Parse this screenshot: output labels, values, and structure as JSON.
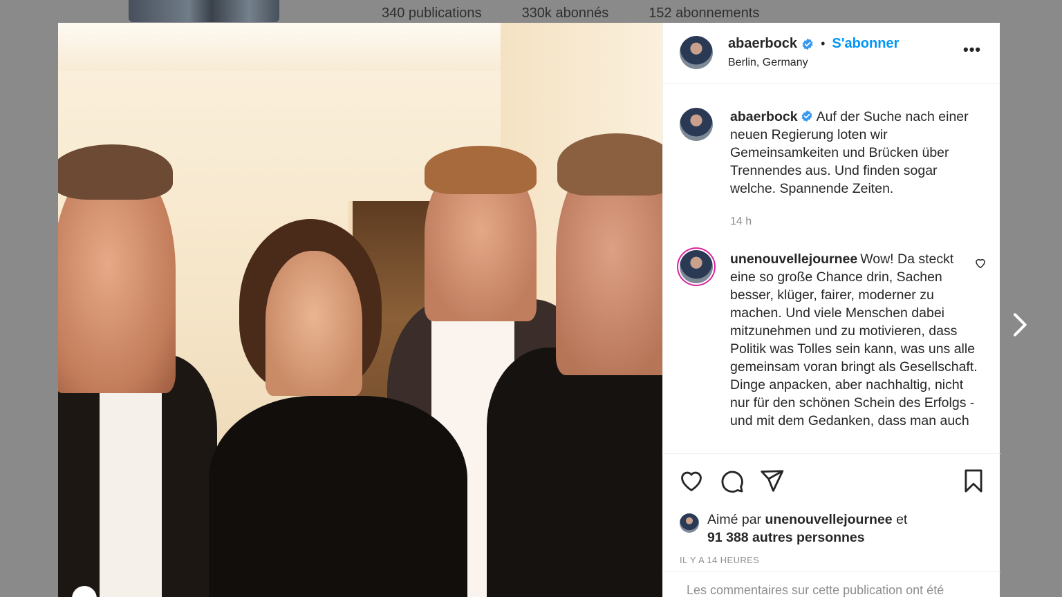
{
  "background_profile": {
    "posts": "340 publications",
    "followers": "330k abonnés",
    "following": "152 abonnements"
  },
  "post": {
    "author": "abaerbock",
    "follow_label": "S'abonner",
    "location": "Berlin, Germany",
    "more_label": "•••",
    "caption": "Auf der Suche nach einer neuen Regierung loten wir Gemeinsamkeiten und Brücken über Trennendes aus. Und finden sogar welche. Spannende Zeiten.",
    "caption_time": "14 h",
    "comment": {
      "author": "unenouvellejournee",
      "text": "Wow! Da steckt eine so große Chance drin, Sachen besser, klüger, fairer, moderner zu machen. Und viele Menschen dabei mitzunehmen und zu motivieren, dass Politik was Tolles sein kann, was uns alle gemeinsam voran bringt als Gesellschaft. Dinge anpacken, aber nachhaltig, nicht nur für den schönen Schein des Erfolgs - und mit dem Gedanken, dass man auch"
    },
    "liked_by_prefix": "Aimé par",
    "liked_by_user": "unenouvellejournee",
    "liked_by_and": "et",
    "liked_by_others": "91 388 autres personnes",
    "timestamp": "IL Y A 14 HEURES",
    "comments_disabled": "Les commentaires sur cette publication ont été"
  },
  "icons": {
    "verified": "verified-badge-icon",
    "like": "heart-icon",
    "comment": "comment-icon",
    "share": "send-icon",
    "save": "bookmark-icon",
    "next": "chevron-right-icon"
  },
  "colors": {
    "accent": "#0095f6",
    "verified": "#3897f0",
    "muted": "#8e8e8e"
  }
}
